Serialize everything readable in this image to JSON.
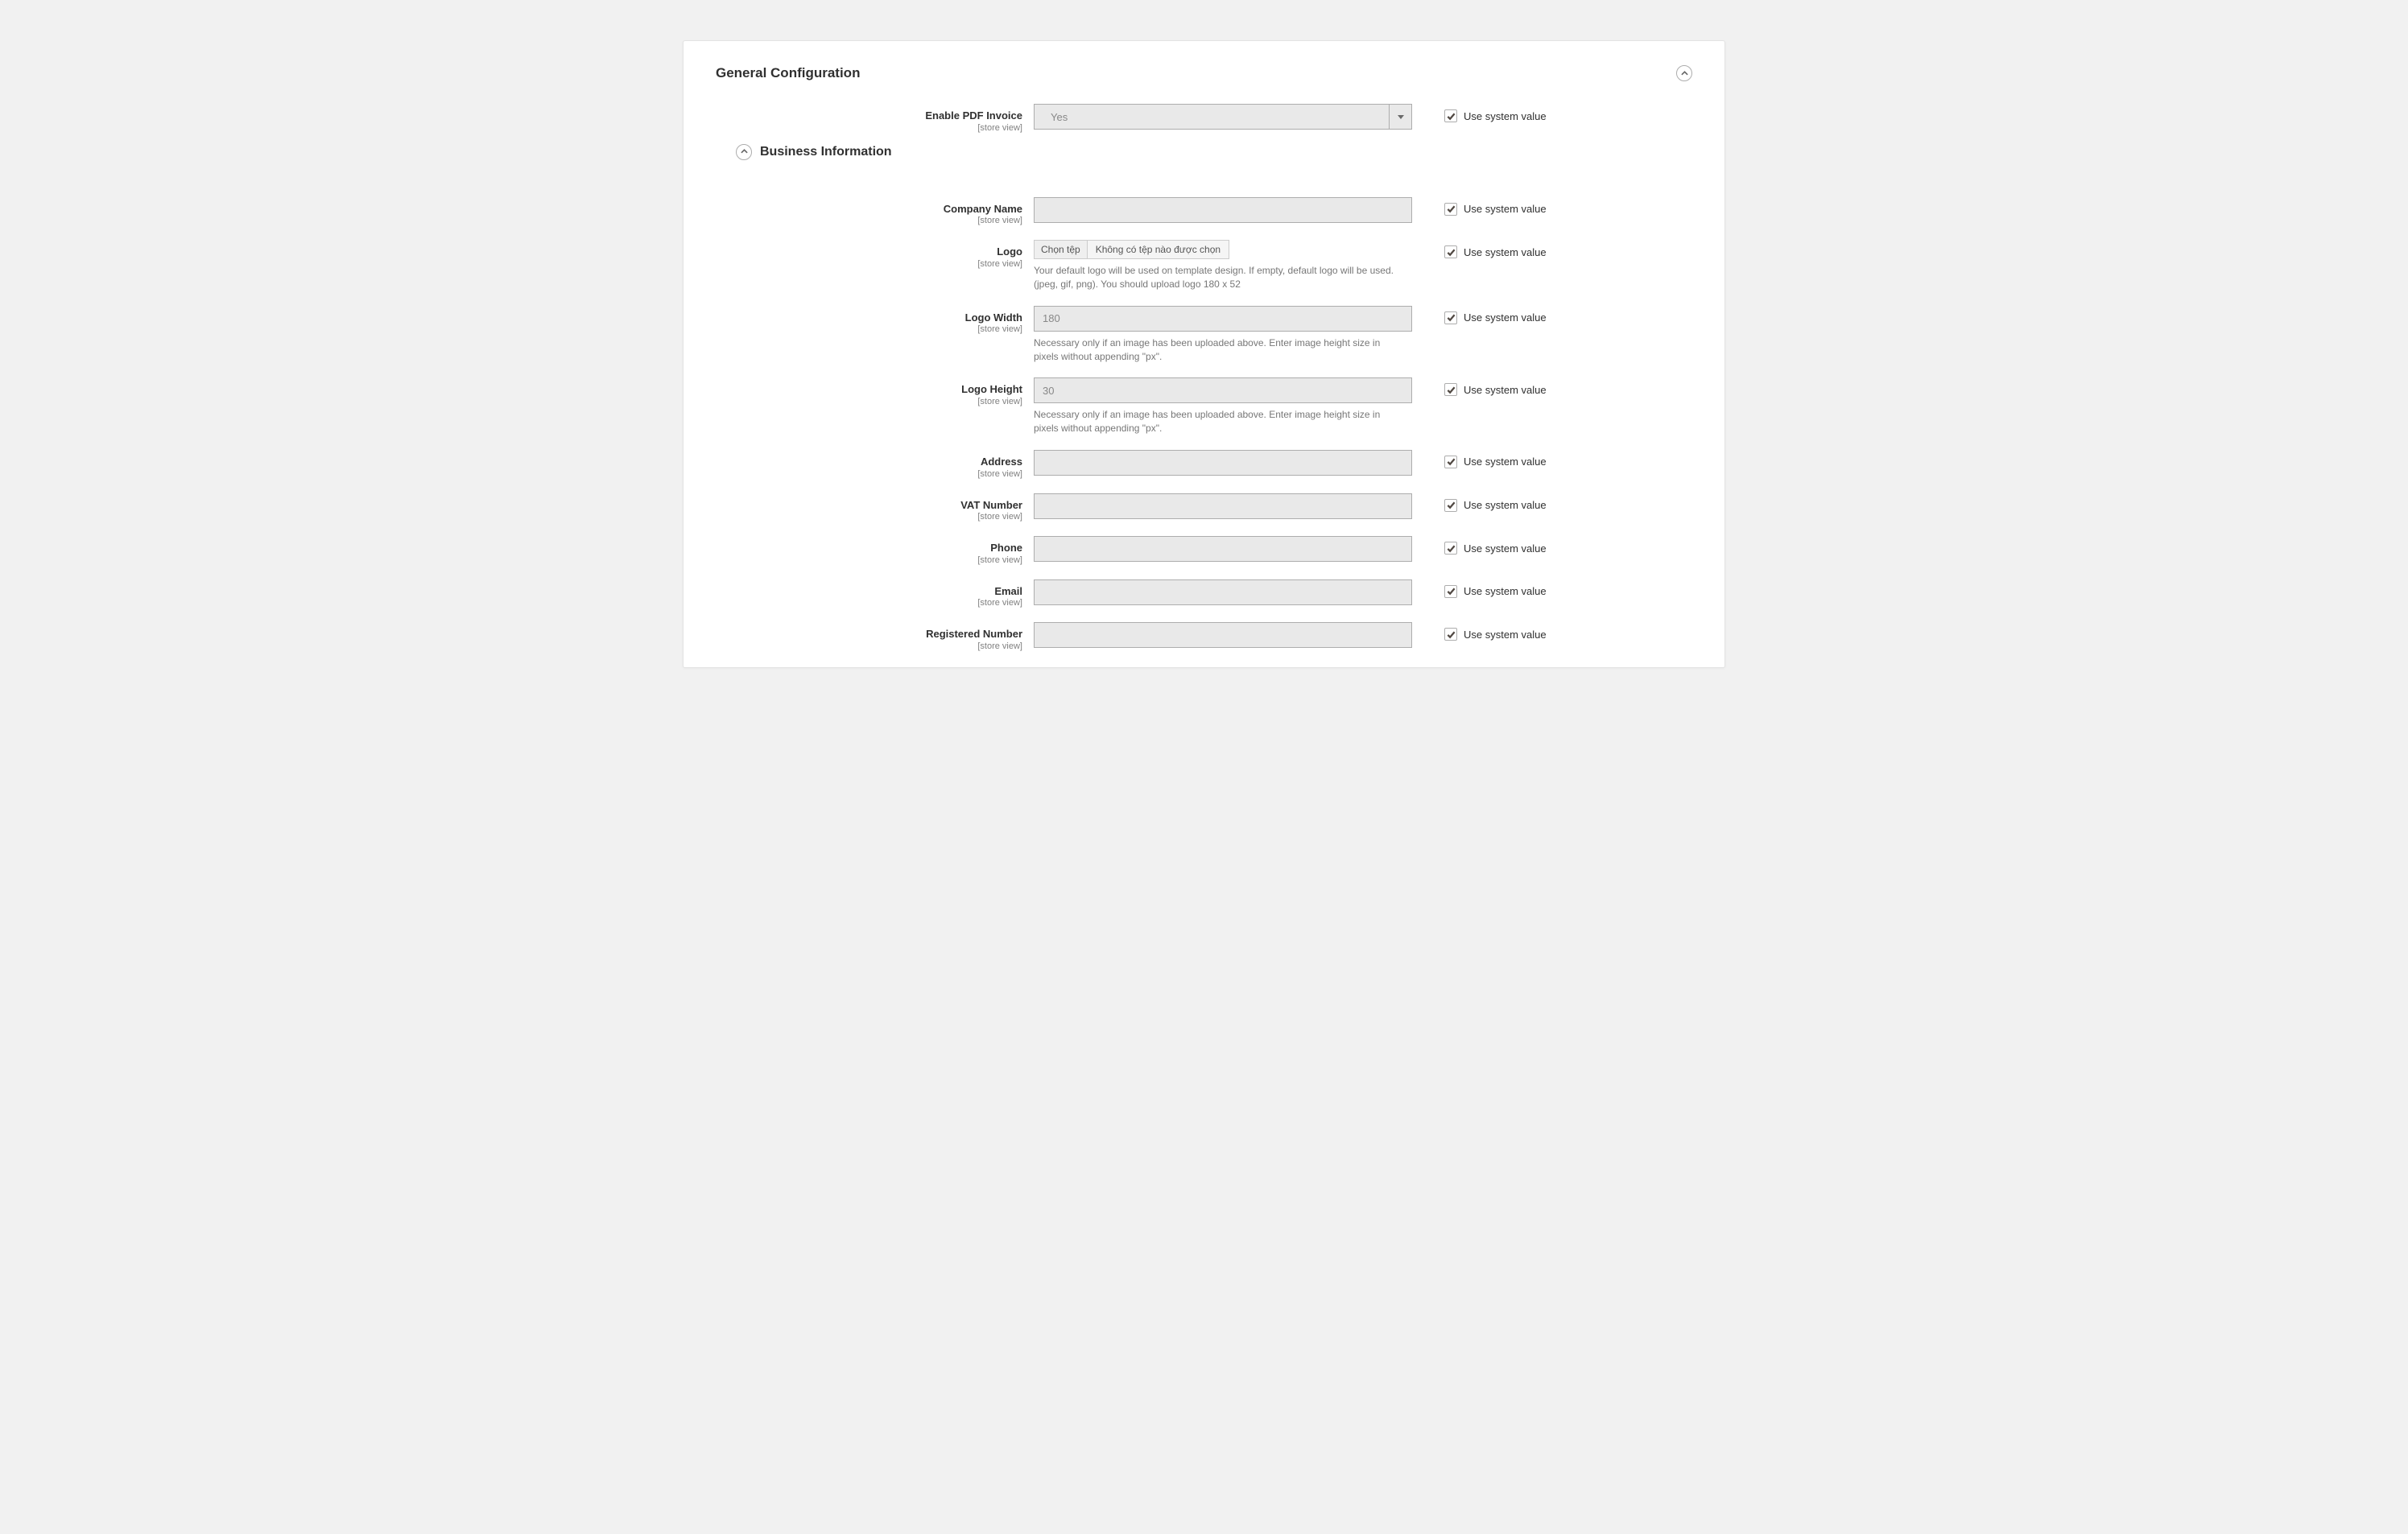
{
  "section": {
    "title": "General Configuration"
  },
  "subsection": {
    "title": "Business Information"
  },
  "common": {
    "scope": "[store view]",
    "use_system": "Use system value"
  },
  "fields": {
    "enable": {
      "label": "Enable PDF Invoice",
      "value": "Yes"
    },
    "company": {
      "label": "Company Name",
      "value": ""
    },
    "logo": {
      "label": "Logo",
      "btn": "Chọn tệp",
      "none": "Không có tệp nào được chọn",
      "help": "Your default logo will be used on template design. If empty, default logo will be used. (jpeg, gif, png). You should upload logo 180 x 52"
    },
    "logo_width": {
      "label": "Logo Width",
      "value": "180",
      "help": "Necessary only if an image has been uploaded above. Enter image height size in pixels without appending \"px\"."
    },
    "logo_height": {
      "label": "Logo Height",
      "value": "30",
      "help": "Necessary only if an image has been uploaded above. Enter image height size in pixels without appending \"px\"."
    },
    "address": {
      "label": "Address",
      "value": ""
    },
    "vat": {
      "label": "VAT Number",
      "value": ""
    },
    "phone": {
      "label": "Phone",
      "value": ""
    },
    "email": {
      "label": "Email",
      "value": ""
    },
    "reg": {
      "label": "Registered Number",
      "value": ""
    }
  }
}
